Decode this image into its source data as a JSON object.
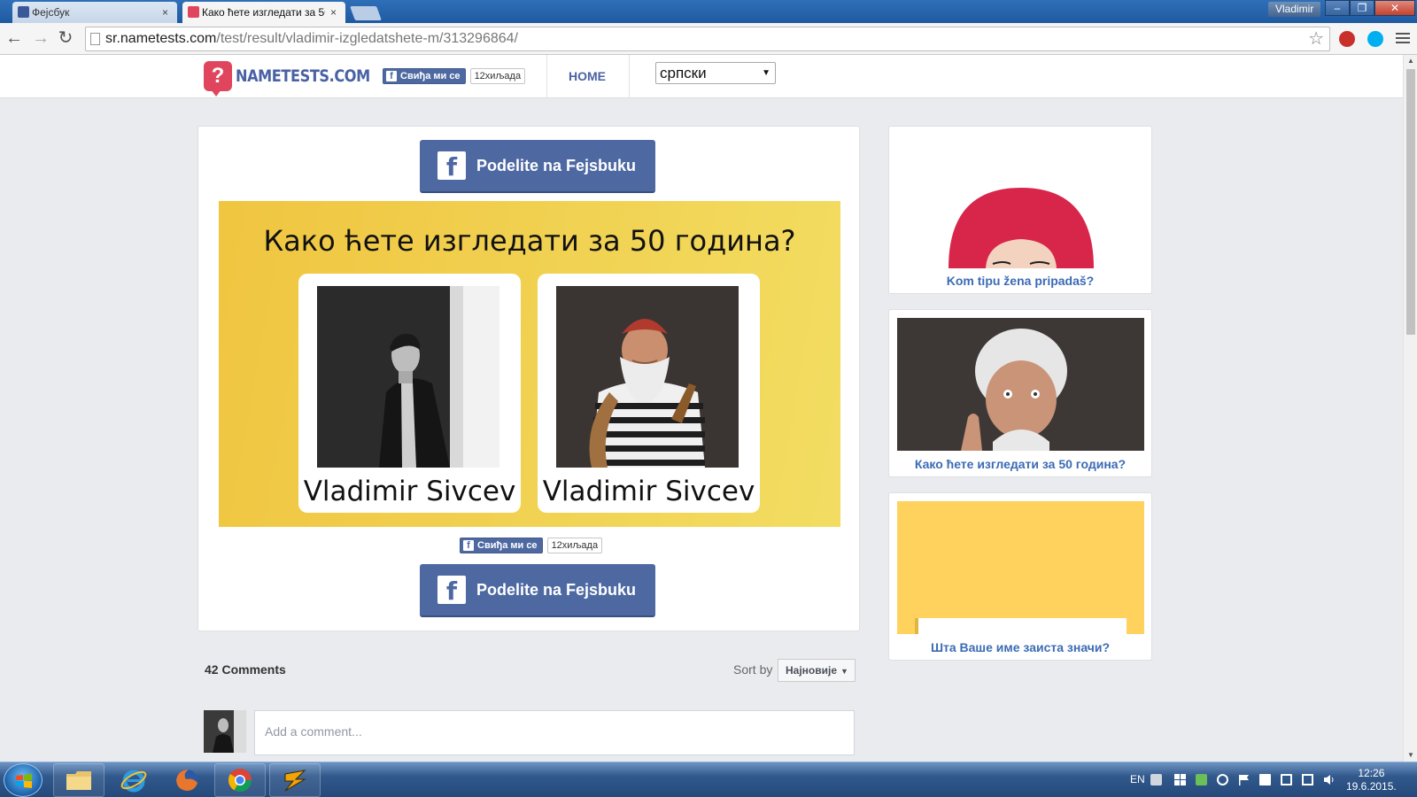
{
  "browser": {
    "tabs": [
      {
        "title": "Фејсбук",
        "close": "×",
        "active": false
      },
      {
        "title": "Како ћете изгледати за 50",
        "close": "×",
        "active": true
      }
    ],
    "user": "Vladimir",
    "window_controls": {
      "minimize": "–",
      "restore": "❐",
      "close": "✕"
    },
    "url_host": "sr.nametests.com",
    "url_path": "/test/result/vladimir-izgledatshete-m/313296864/",
    "nav": {
      "back": "←",
      "forward": "→",
      "reload": "↻",
      "star": "☆"
    },
    "extensions": [
      "adblock-icon",
      "skype-icon"
    ]
  },
  "site": {
    "logo_text": "NAMETESTS.COM",
    "logo_mark": "?",
    "like_label": "Свиђа ми се",
    "like_count": "12хиљада",
    "fb_letter": "f",
    "home": "HOME",
    "language": "српски",
    "dropdown_arrow": "▼"
  },
  "result": {
    "share_label": "Podelite na Fejsbuku",
    "title": "Како ћете изгледати за 50 година?",
    "name_now": "Vladimir Sivcev",
    "name_future": "Vladimir Sivcev"
  },
  "comments": {
    "count": "42 Comments",
    "sort_label": "Sort by",
    "sort_value": "Најновије",
    "sort_arrow": "▼",
    "placeholder": "Add a comment..."
  },
  "sidebar": [
    {
      "caption": "Kom tipu žena pripadaš?"
    },
    {
      "caption": "Како ћете изгледати за 50 година?"
    },
    {
      "caption": "Шта Ваше име заиста значи?"
    }
  ],
  "scrollbar": {
    "up": "▲",
    "down": "▼"
  },
  "taskbar": {
    "language": "EN",
    "time": "12:26",
    "date": "19.6.2015."
  },
  "colors": {
    "facebook_blue": "#4e69a2",
    "nametests_pink": "#e0455e",
    "banner_yellow": "#f2cf4a",
    "caption_blue": "#3b6bb5"
  }
}
